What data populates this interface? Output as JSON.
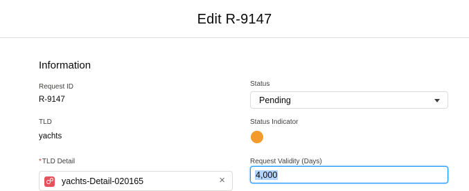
{
  "modal": {
    "title": "Edit R-9147"
  },
  "section": {
    "title": "Information"
  },
  "fields": {
    "request_id": {
      "label": "Request ID",
      "value": "R-9147"
    },
    "status": {
      "label": "Status",
      "value": "Pending"
    },
    "tld": {
      "label": "TLD",
      "value": "yachts"
    },
    "status_indicator": {
      "label": "Status Indicator",
      "color": "#f39a2c"
    },
    "tld_detail": {
      "label": "TLD Detail",
      "required_marker": "*",
      "value": "yachts-Detail-020165",
      "clear_icon": "×"
    },
    "request_validity": {
      "label": "Request Validity (Days)",
      "value": "4,000"
    }
  },
  "icons": {
    "status_caret": "chevron-down-icon",
    "lookup_record": "record-icon",
    "lookup_clear": "close-icon"
  }
}
